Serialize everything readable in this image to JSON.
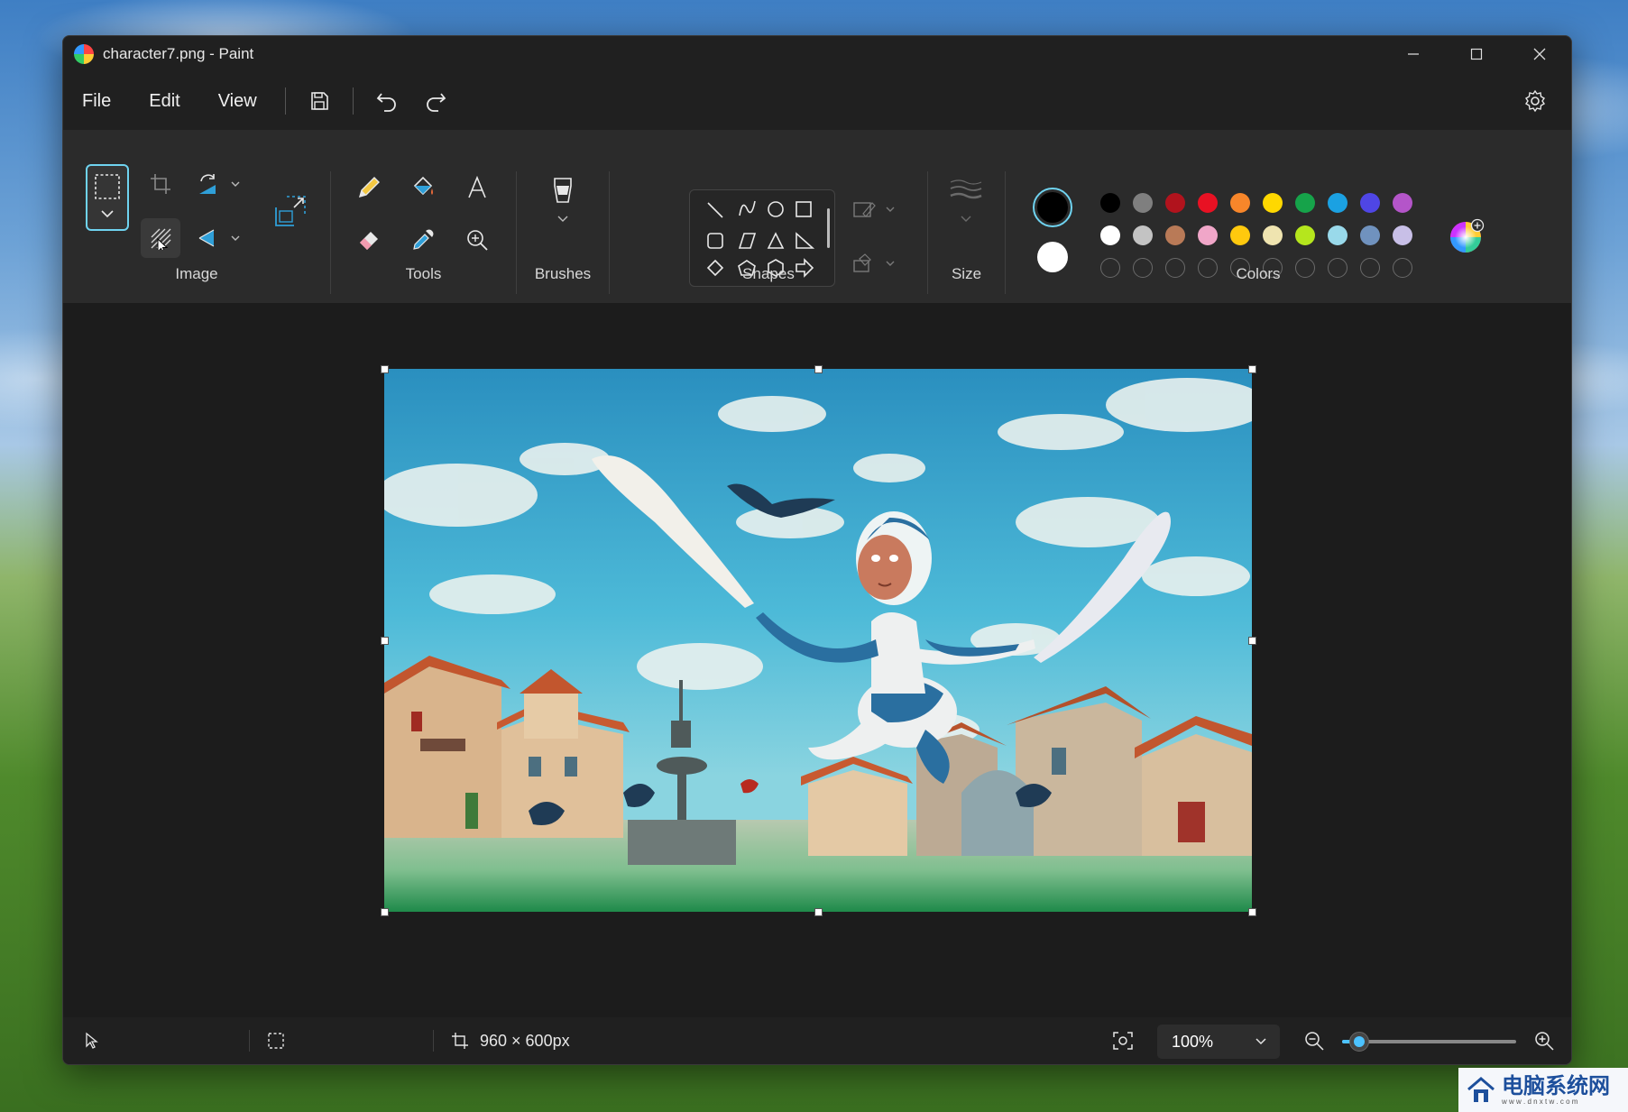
{
  "window": {
    "title": "character7.png - Paint"
  },
  "menu": {
    "items": [
      "File",
      "Edit",
      "View"
    ]
  },
  "ribbon": {
    "groups": {
      "image": "Image",
      "tools": "Tools",
      "brushes": "Brushes",
      "shapes": "Shapes",
      "size": "Size",
      "colors": "Colors"
    },
    "primary_color": "#000000",
    "secondary_color": "#ffffff",
    "palette_row1": [
      "#000000",
      "#7f7f7f",
      "#b1131d",
      "#e81123",
      "#f7862a",
      "#ffd800",
      "#16a34a",
      "#1ba1e2",
      "#4f46e5",
      "#b455c9"
    ],
    "palette_row2": [
      "#ffffff",
      "#c3c3c3",
      "#b97a57",
      "#f0a6c8",
      "#ffc90e",
      "#efe4b0",
      "#b5e61d",
      "#99d9ea",
      "#7092be",
      "#c8bfe7"
    ]
  },
  "status": {
    "image_size": "960 × 600px",
    "zoom": "100%",
    "zoom_fraction": 0.1
  },
  "watermark": {
    "text": "电脑系统网",
    "subtext": "w w w . d n x t w . c o m"
  }
}
